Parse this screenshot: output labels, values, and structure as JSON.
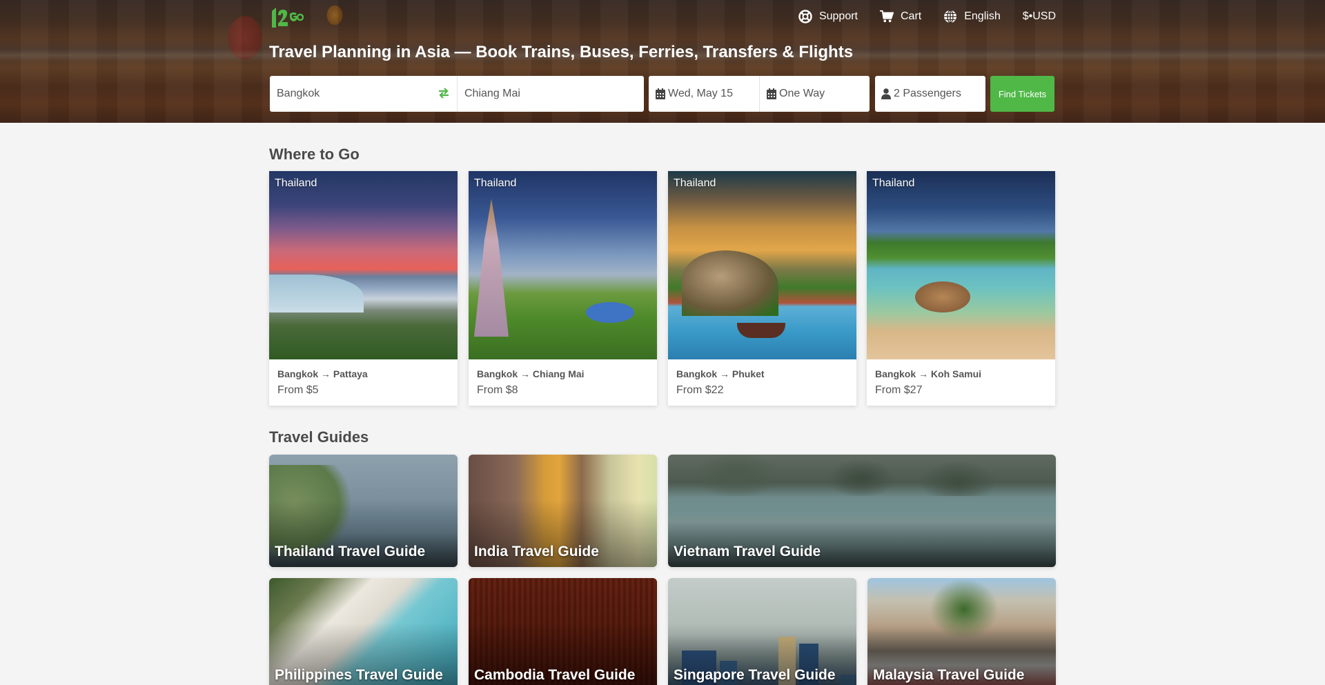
{
  "brand": {
    "logo_text": "12Go",
    "accent": "#4fb847"
  },
  "topnav": {
    "items": [
      {
        "icon": "lifebuoy-icon",
        "label": "Support"
      },
      {
        "icon": "cart-icon",
        "label": "Cart"
      },
      {
        "icon": "globe-icon",
        "label": "English"
      },
      {
        "icon": "",
        "label": "$•USD"
      }
    ]
  },
  "hero": {
    "title": "Travel Planning in Asia — Book Trains, Buses, Ferries, Transfers & Flights"
  },
  "search": {
    "from": "Bangkok",
    "to": "Chiang Mai",
    "date": "Wed, May 15",
    "trip_type": "One Way",
    "passengers": "2 Passengers",
    "submit_label": "Find Tickets"
  },
  "where_to_go": {
    "title": "Where to Go",
    "cards": [
      {
        "country": "Thailand",
        "route": "Bangkok → Pattaya",
        "price": "From $5"
      },
      {
        "country": "Thailand",
        "route": "Bangkok → Chiang Mai",
        "price": "From $8"
      },
      {
        "country": "Thailand",
        "route": "Bangkok → Phuket",
        "price": "From $22"
      },
      {
        "country": "Thailand",
        "route": "Bangkok → Koh Samui",
        "price": "From $27"
      }
    ]
  },
  "travel_guides": {
    "title": "Travel Guides",
    "cards": [
      {
        "label": "Thailand Travel Guide"
      },
      {
        "label": "India Travel Guide"
      },
      {
        "label": "Vietnam Travel Guide"
      },
      {
        "label": "Philippines Travel Guide"
      },
      {
        "label": "Cambodia Travel Guide"
      },
      {
        "label": "Singapore Travel Guide"
      },
      {
        "label": "Malaysia Travel Guide"
      }
    ]
  }
}
